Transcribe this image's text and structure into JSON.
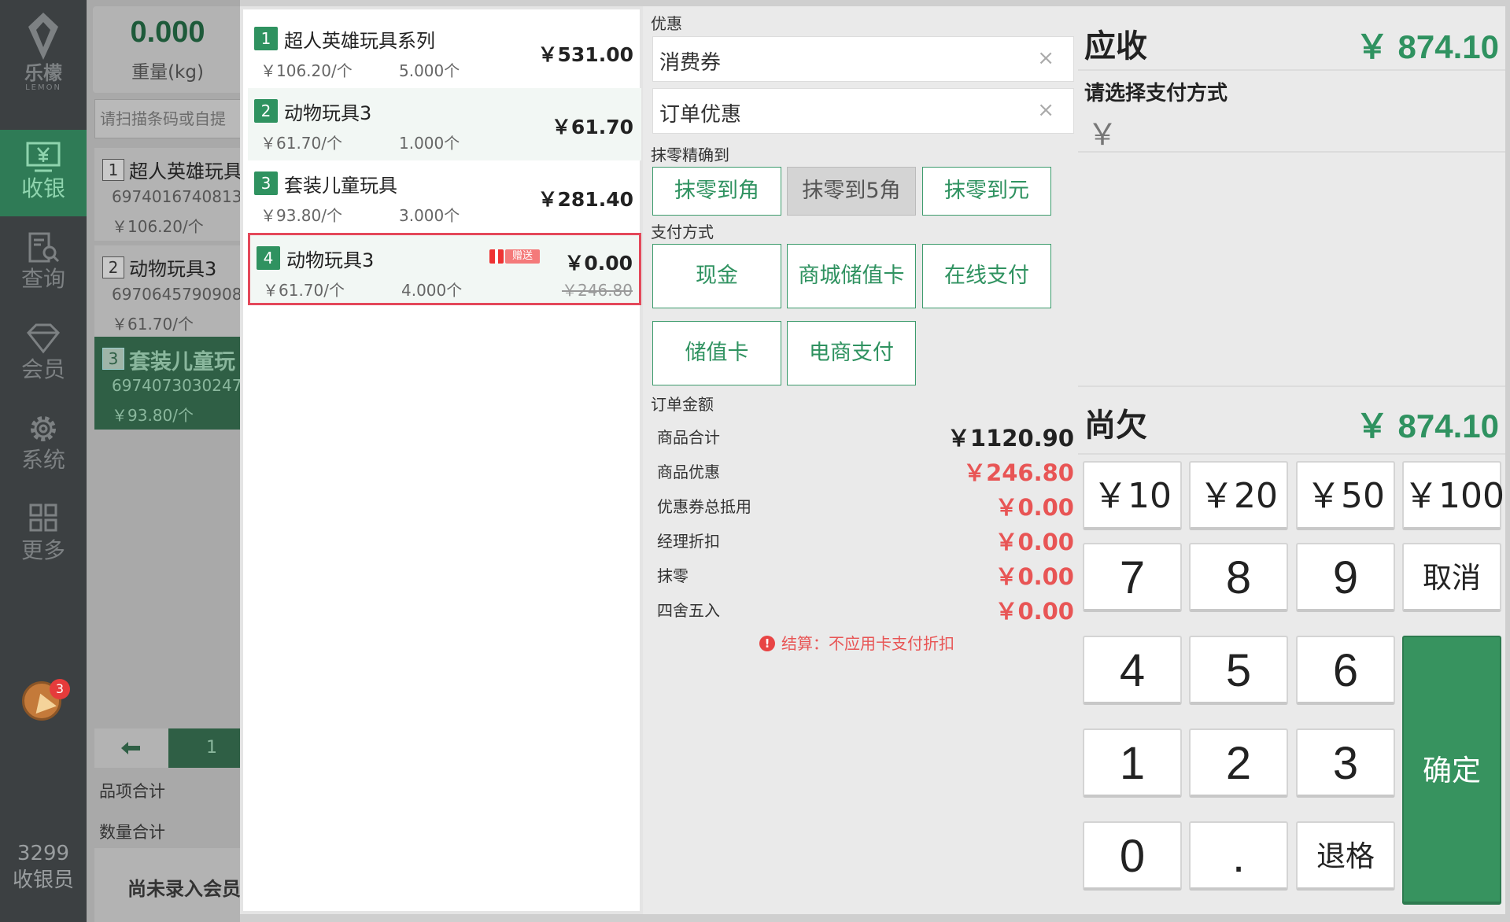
{
  "nav": {
    "logo_cn": "乐檬",
    "logo_en": "LEMON",
    "items": [
      {
        "label": "收银",
        "icon": "cash-register-icon"
      },
      {
        "label": "查询",
        "icon": "search-doc-icon"
      },
      {
        "label": "会员",
        "icon": "diamond-icon"
      },
      {
        "label": "系统",
        "icon": "gear-icon"
      },
      {
        "label": "更多",
        "icon": "grid-icon"
      }
    ],
    "notification_count": "3",
    "cashier_id": "3299",
    "cashier_role": "收银员"
  },
  "background": {
    "scale_value": "0.000",
    "scale_unit": "重量(kg)",
    "scan_placeholder": "请扫描条码或自提",
    "cart": [
      {
        "num": "1",
        "name": "超人英雄玩具",
        "code": "6974016740813",
        "price": "￥106.20/个"
      },
      {
        "num": "2",
        "name": "动物玩具3",
        "code": "6970645790908",
        "price": "￥61.70/个"
      },
      {
        "num": "3",
        "name": "套装儿童玩",
        "code": "6974073030247",
        "price": "￥93.80/个"
      }
    ],
    "page": "1",
    "item_total_label": "品项合计",
    "qty_total_label": "数量合计",
    "member_label": "尚未录入会员"
  },
  "items": [
    {
      "num": "1",
      "name": "超人英雄玩具系列",
      "unit_price": "￥106.20/个",
      "qty": "5.000个",
      "total": "￥531.00"
    },
    {
      "num": "2",
      "name": "动物玩具3",
      "unit_price": "￥61.70/个",
      "qty": "1.000个",
      "total": "￥61.70"
    },
    {
      "num": "3",
      "name": "套装儿童玩具",
      "unit_price": "￥93.80/个",
      "qty": "3.000个",
      "total": "￥281.40"
    },
    {
      "num": "4",
      "name": "动物玩具3",
      "unit_price": "￥61.70/个",
      "qty": "4.000个",
      "total": "￥0.00",
      "original": "￥246.80",
      "gift_label": "赠送"
    }
  ],
  "discount": {
    "section_label": "优惠",
    "coupon_label": "消费券",
    "order_discount_label": "订单优惠",
    "clear_symbol": "×"
  },
  "rounding": {
    "section_label": "抹零精确到",
    "options": [
      "抹零到角",
      "抹零到5角",
      "抹零到元"
    ],
    "selected": "抹零到5角"
  },
  "payment_methods": {
    "section_label": "支付方式",
    "options": [
      "现金",
      "商城储值卡",
      "在线支付",
      "储值卡",
      "电商支付"
    ]
  },
  "order_amount": {
    "section_label": "订单金额",
    "rows": [
      {
        "label": "商品合计",
        "value": "￥1120.90"
      },
      {
        "label": "商品优惠",
        "value": "￥246.80"
      },
      {
        "label": "优惠券总抵用",
        "value": "￥0.00"
      },
      {
        "label": "经理折扣",
        "value": "￥0.00"
      },
      {
        "label": "抹零",
        "value": "￥0.00"
      },
      {
        "label": "四舍五入",
        "value": "￥0.00"
      }
    ],
    "notice_icon": "!",
    "notice": "结算：不应用卡支付折扣"
  },
  "payment": {
    "receivable_label": "应收",
    "receivable_value": "￥ 874.10",
    "choose_label": "请选择支付方式",
    "amount_placeholder": "￥",
    "owed_label": "尚欠",
    "owed_value": "￥ 874.10",
    "quick_amounts": [
      "￥10",
      "￥20",
      "￥50",
      "￥100"
    ],
    "digits": [
      "7",
      "8",
      "9",
      "4",
      "5",
      "6",
      "1",
      "2",
      "3",
      "0",
      "."
    ],
    "cancel_label": "取消",
    "confirm_label": "确定",
    "backspace_label": "退格"
  },
  "colors": {
    "accent_green": "#2f9260",
    "sidebar_bg": "#3c4042",
    "discount_red": "#e85555",
    "highlight_border": "#e4485a"
  }
}
